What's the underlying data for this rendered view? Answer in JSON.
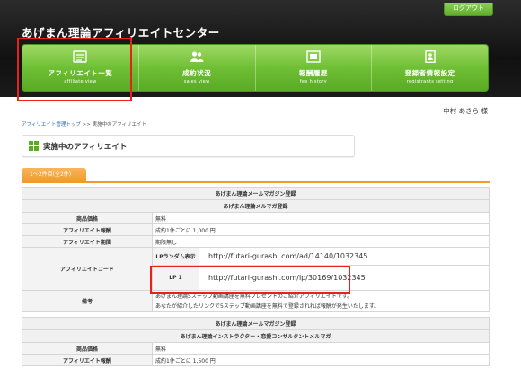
{
  "header": {
    "logout_label": "ログアウト",
    "site_title": "あげまん理論アフィリエイトセンター"
  },
  "nav": [
    {
      "label": "アフィリエイト一覧",
      "sub": "affiliate view",
      "icon": "list-icon"
    },
    {
      "label": "成約状況",
      "sub": "sales view",
      "icon": "users-icon"
    },
    {
      "label": "報酬履歴",
      "sub": "fee history",
      "icon": "ledger-icon"
    },
    {
      "label": "登録者情報設定",
      "sub": "registrants setting",
      "icon": "profile-icon"
    }
  ],
  "user": {
    "name": "中村 あきら 様"
  },
  "breadcrumb": {
    "link": "アフィリエイト管理トップ",
    "current": ">> 実施中のアフィリエイト"
  },
  "section_title": "実施中のアフィリエイト",
  "count_label": "1〜2件目(全2件)",
  "affiliates": [
    {
      "title_line1": "あげまん理論メールマガジン登録",
      "title_line2": "あげまん理論メルマガ登録",
      "price_label": "商品価格",
      "price": "無料",
      "fee_label": "アフィリエイト報酬",
      "fee": "成約1件ごとに 1,000 円",
      "period_label": "アフィリエイト期間",
      "period": "期限無し",
      "code_label": "アフィリエイトコード",
      "random_label": "LPランダム表示",
      "random_url": "http://futari-gurashi.com/ad/14140/1032345",
      "lp_label": "LP 1",
      "lp_url": "http://futari-gurashi.com/lp/30169/1032345",
      "note_label": "備考",
      "note_line1": "あげまん理論5ステップ動画講座を無料プレゼントのご紹介アフィリエイトです。",
      "note_line2": "あなたが紹介したリンクで5ステップ動画講座を無料で登録されれば報酬が発生いたします。"
    },
    {
      "title_line1": "あげまん理論メールマガジン登録",
      "title_line2": "あげまん理論インストラクター・恋愛コンサルタントメルマガ",
      "price_label": "商品価格",
      "price": "無料",
      "fee_label": "アフィリエイト報酬",
      "fee": "成約1件ごとに 1,500 円"
    }
  ],
  "colors": {
    "accent_green": "#6fbf35",
    "tab_orange": "#f29a2e",
    "highlight_red": "#e8211a"
  }
}
